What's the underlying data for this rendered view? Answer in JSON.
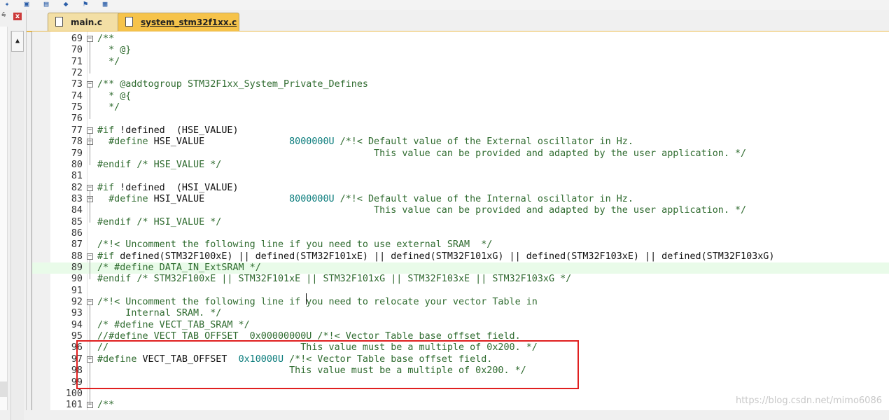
{
  "tabs": [
    {
      "label": "main.c",
      "active": false
    },
    {
      "label": "system_stm32f1xx.c",
      "active": true
    }
  ],
  "left_panel": {
    "pin": "⩯",
    "close": "x",
    "scroll_up": "▲"
  },
  "toolbar_icons": [
    "✦",
    "▣",
    "▤",
    "◆",
    "⚑",
    "▦"
  ],
  "code_lines": [
    {
      "n": "69",
      "fold": "−",
      "segs": [
        {
          "t": "/**",
          "c": "c"
        }
      ]
    },
    {
      "n": "70",
      "segs": [
        {
          "t": "  * @}",
          "c": "c"
        }
      ]
    },
    {
      "n": "71",
      "segs": [
        {
          "t": "  */",
          "c": "c"
        }
      ]
    },
    {
      "n": "72",
      "segs": []
    },
    {
      "n": "73",
      "fold": "−",
      "segs": [
        {
          "t": "/** @addtogroup STM32F1xx_System_Private_Defines",
          "c": "c"
        }
      ]
    },
    {
      "n": "74",
      "segs": [
        {
          "t": "  * @{",
          "c": "c"
        }
      ]
    },
    {
      "n": "75",
      "segs": [
        {
          "t": "  */",
          "c": "c"
        }
      ]
    },
    {
      "n": "76",
      "segs": []
    },
    {
      "n": "77",
      "fold": "−",
      "segs": [
        {
          "t": "#if ",
          "c": "c"
        },
        {
          "t": "!defined  (HSE_VALUE)",
          "c": "k"
        }
      ]
    },
    {
      "n": "78",
      "fold": "−",
      "segs": [
        {
          "t": "  #define ",
          "c": "c"
        },
        {
          "t": "HSE_VALUE",
          "c": "k"
        },
        {
          "t": "               ",
          "c": "k"
        },
        {
          "t": "8000000U",
          "c": "n"
        },
        {
          "t": " /*!< Default value of the External oscillator in Hz.",
          "c": "c"
        }
      ]
    },
    {
      "n": "79",
      "segs": [
        {
          "t": "                                                 This value can be provided and adapted by the user application. */",
          "c": "c"
        }
      ]
    },
    {
      "n": "80",
      "segs": [
        {
          "t": "#endif /* HSE_VALUE */",
          "c": "c"
        }
      ]
    },
    {
      "n": "81",
      "segs": []
    },
    {
      "n": "82",
      "fold": "−",
      "segs": [
        {
          "t": "#if ",
          "c": "c"
        },
        {
          "t": "!defined  (HSI_VALUE)",
          "c": "k"
        }
      ]
    },
    {
      "n": "83",
      "fold": "−",
      "segs": [
        {
          "t": "  #define ",
          "c": "c"
        },
        {
          "t": "HSI_VALUE",
          "c": "k"
        },
        {
          "t": "               ",
          "c": "k"
        },
        {
          "t": "8000000U",
          "c": "n"
        },
        {
          "t": " /*!< Default value of the Internal oscillator in Hz.",
          "c": "c"
        }
      ]
    },
    {
      "n": "84",
      "segs": [
        {
          "t": "                                                 This value can be provided and adapted by the user application. */",
          "c": "c"
        }
      ]
    },
    {
      "n": "85",
      "segs": [
        {
          "t": "#endif /* HSI_VALUE */",
          "c": "c"
        }
      ]
    },
    {
      "n": "86",
      "segs": []
    },
    {
      "n": "87",
      "segs": [
        {
          "t": "/*!< Uncomment the following line if you need to use external SRAM  */",
          "c": "c"
        }
      ]
    },
    {
      "n": "88",
      "fold": "−",
      "segs": [
        {
          "t": "#if ",
          "c": "c"
        },
        {
          "t": "defined(STM32F100xE) || defined(STM32F101xE) || defined(STM32F101xG) || defined(STM32F103xE) || defined(STM32F103xG)",
          "c": "k"
        }
      ]
    },
    {
      "n": "89",
      "hl": true,
      "segs": [
        {
          "t": "/* #define DATA_IN_ExtSRAM */",
          "c": "c"
        }
      ]
    },
    {
      "n": "90",
      "segs": [
        {
          "t": "#endif /* STM32F100xE || STM32F101xE || STM32F101xG || STM32F103xE || STM32F103xG */",
          "c": "c"
        }
      ]
    },
    {
      "n": "91",
      "segs": []
    },
    {
      "n": "92",
      "fold": "−",
      "segs": [
        {
          "t": "/*!< Uncomment the following line if you need to relocate your vector Table in",
          "c": "c"
        }
      ]
    },
    {
      "n": "93",
      "segs": [
        {
          "t": "     Internal SRAM. */",
          "c": "c"
        }
      ]
    },
    {
      "n": "94",
      "segs": [
        {
          "t": "/* #define VECT_TAB_SRAM */",
          "c": "c"
        }
      ]
    },
    {
      "n": "95",
      "segs": [
        {
          "t": "//#define VECT_TAB_OFFSET  0x00000000U /*!< Vector Table base offset field.",
          "c": "c"
        }
      ]
    },
    {
      "n": "96",
      "segs": [
        {
          "t": "//                                  This value must be a multiple of 0x200. */",
          "c": "c"
        }
      ]
    },
    {
      "n": "97",
      "fold": "−",
      "segs": [
        {
          "t": "#define ",
          "c": "c"
        },
        {
          "t": "VECT_TAB_OFFSET  ",
          "c": "k"
        },
        {
          "t": "0x10000U",
          "c": "n"
        },
        {
          "t": " /*!< Vector Table base offset field.",
          "c": "c"
        }
      ]
    },
    {
      "n": "98",
      "segs": [
        {
          "t": "                                  This value must be a multiple of 0x200. */",
          "c": "c"
        }
      ]
    },
    {
      "n": "99",
      "segs": []
    },
    {
      "n": "100",
      "segs": []
    },
    {
      "n": "101",
      "fold": "−",
      "segs": [
        {
          "t": "/**",
          "c": "c"
        }
      ]
    }
  ],
  "watermark": "https://blog.csdn.net/mimo6086"
}
